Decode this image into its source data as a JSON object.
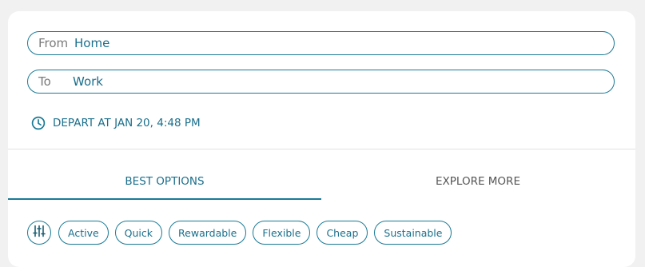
{
  "route": {
    "from_label": "From",
    "from_value": "Home",
    "to_label": "To",
    "to_value": "Work"
  },
  "depart": {
    "text": "DEPART AT JAN 20, 4:48 PM",
    "icon": "clock-icon"
  },
  "tabs": [
    {
      "label": "BEST OPTIONS",
      "active": true
    },
    {
      "label": "EXPLORE MORE",
      "active": false
    }
  ],
  "filters": {
    "icon": "sliders-icon",
    "chips": [
      "Active",
      "Quick",
      "Rewardable",
      "Flexible",
      "Cheap",
      "Sustainable"
    ]
  },
  "colors": {
    "accent": "#1a7a96",
    "background": "#f1f1f2",
    "card": "#ffffff"
  }
}
